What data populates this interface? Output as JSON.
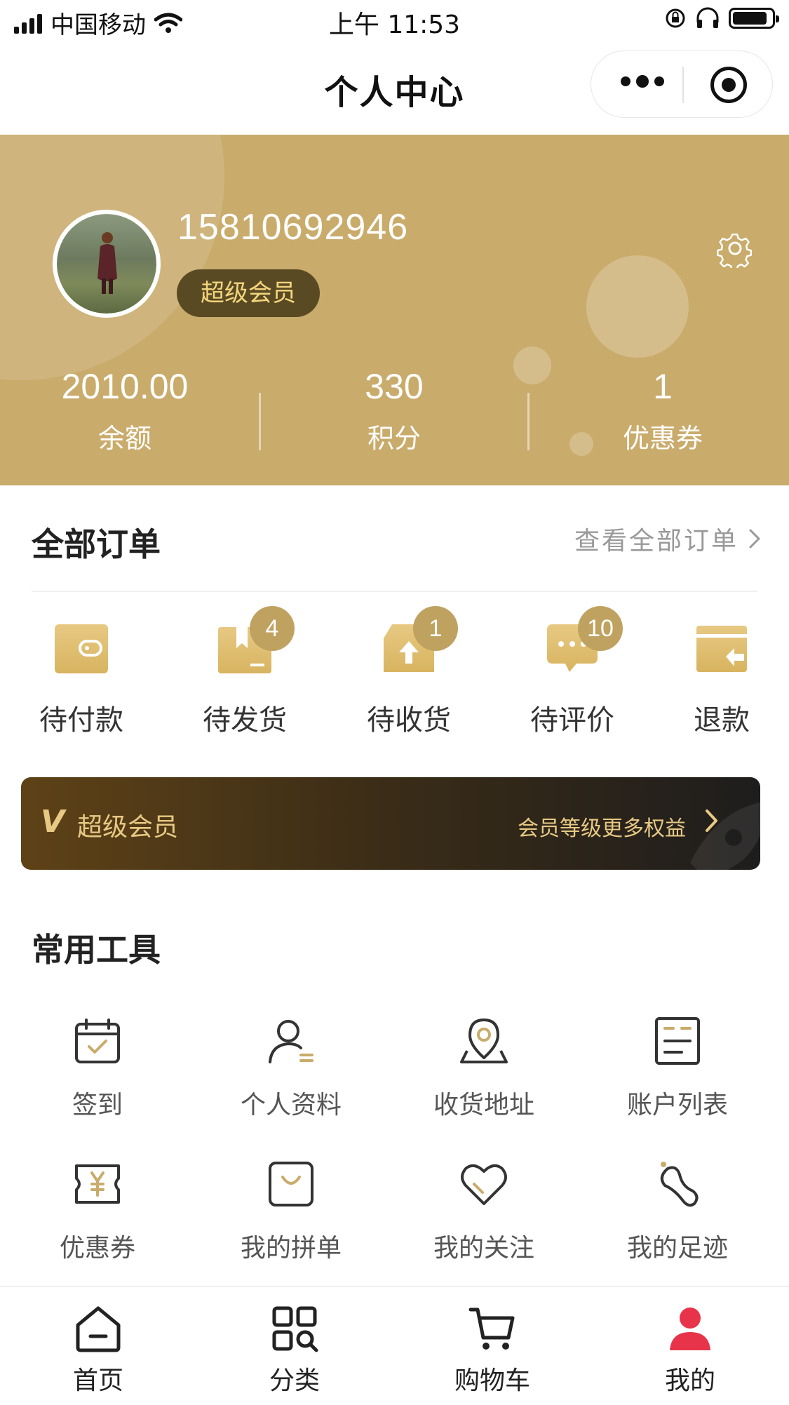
{
  "status_bar": {
    "carrier": "中国移动",
    "time": "上午 11:53"
  },
  "nav": {
    "title": "个人中心"
  },
  "profile": {
    "phone": "15810692946",
    "member_level": "超级会员",
    "stats": [
      {
        "value": "2010.00",
        "label": "余额"
      },
      {
        "value": "330",
        "label": "积分"
      },
      {
        "value": "1",
        "label": "优惠券"
      }
    ]
  },
  "orders": {
    "title": "全部订单",
    "view_all": "查看全部订单",
    "items": [
      {
        "label": "待付款",
        "badge": "",
        "icon": "wallet-icon"
      },
      {
        "label": "待发货",
        "badge": "4",
        "icon": "box-icon"
      },
      {
        "label": "待收货",
        "badge": "1",
        "icon": "package-upload-icon"
      },
      {
        "label": "待评价",
        "badge": "10",
        "icon": "chat-bubble-icon"
      },
      {
        "label": "退款",
        "badge": "",
        "icon": "refund-icon"
      }
    ]
  },
  "vip_banner": {
    "icon_text": "V",
    "title": "超级会员",
    "link": "会员等级更多权益"
  },
  "tools": {
    "title": "常用工具",
    "items": [
      {
        "label": "签到",
        "icon": "calendar-check-icon"
      },
      {
        "label": "个人资料",
        "icon": "user-profile-icon"
      },
      {
        "label": "收货地址",
        "icon": "location-icon"
      },
      {
        "label": "账户列表",
        "icon": "list-icon"
      },
      {
        "label": "优惠券",
        "icon": "coupon-icon"
      },
      {
        "label": "我的拼单",
        "icon": "shopping-bag-icon"
      },
      {
        "label": "我的关注",
        "icon": "heart-icon"
      },
      {
        "label": "我的足迹",
        "icon": "footprint-icon"
      }
    ]
  },
  "tabbar": {
    "items": [
      {
        "label": "首页",
        "icon": "home-icon"
      },
      {
        "label": "分类",
        "icon": "category-icon"
      },
      {
        "label": "购物车",
        "icon": "cart-icon"
      },
      {
        "label": "我的",
        "icon": "user-icon",
        "active": true
      }
    ]
  },
  "colors": {
    "header_bg": "#c9ab6b",
    "badge_bg": "#bfa25f",
    "accent_red": "#e8344a",
    "vip_gold": "#e7c983"
  }
}
